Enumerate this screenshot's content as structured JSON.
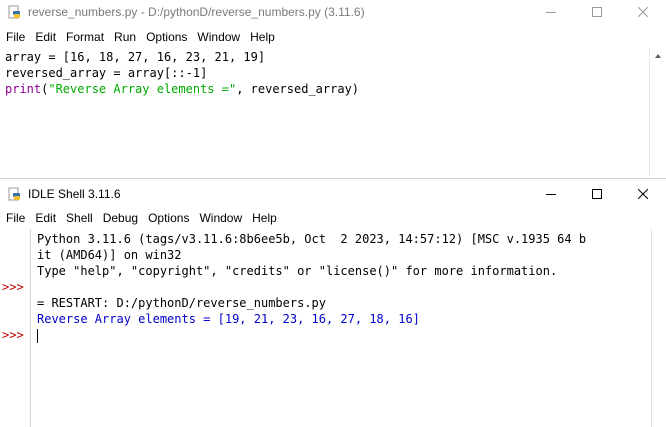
{
  "editor": {
    "title": "reverse_numbers.py - D:/pythonD/reverse_numbers.py (3.11.6)",
    "menu": [
      "File",
      "Edit",
      "Format",
      "Run",
      "Options",
      "Window",
      "Help"
    ],
    "code": {
      "line1": "array = [16, 18, 27, 16, 23, 21, 19]",
      "line2": "reversed_array = array[::-1]",
      "line3_func": "print",
      "line3_open": "(",
      "line3_string": "\"Reverse Array elements =\"",
      "line3_rest": ", reversed_array)"
    }
  },
  "shell": {
    "title": "IDLE Shell 3.11.6",
    "menu": [
      "File",
      "Edit",
      "Shell",
      "Debug",
      "Options",
      "Window",
      "Help"
    ],
    "prompt": ">>>",
    "lines": {
      "banner1": "Python 3.11.6 (tags/v3.11.6:8b6ee5b, Oct  2 2023, 14:57:12) [MSC v.1935 64 b",
      "banner2": "it (AMD64)] on win32",
      "banner3": "Type \"help\", \"copyright\", \"credits\" or \"license()\" for more information.",
      "restart": "= RESTART: D:/pythonD/reverse_numbers.py",
      "output": "Reverse Array elements = [19, 21, 23, 16, 27, 18, 16]"
    }
  },
  "colors": {
    "builtin": "#900090",
    "string": "#00aa00",
    "output": "#0000cc",
    "prompt": "#c00000"
  },
  "icons": [
    "python-file-icon",
    "minimize-icon",
    "maximize-icon",
    "close-icon"
  ]
}
